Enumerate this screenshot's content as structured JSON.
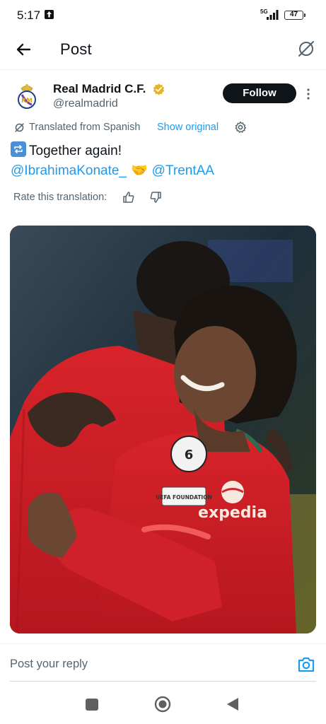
{
  "status_bar": {
    "time": "5:17",
    "network": "5G",
    "battery": "47"
  },
  "header": {
    "title": "Post"
  },
  "post": {
    "author": {
      "display_name": "Real Madrid C.F.",
      "handle": "@realmadrid"
    },
    "follow_label": "Follow",
    "translated_label": "Translated from Spanish",
    "show_original_label": "Show original",
    "text_line1": "Together again!",
    "mention1": "@IbrahimaKonate_",
    "handshake": "🤝",
    "mention2": "@TrentAA",
    "rate_label": "Rate this translation:"
  },
  "photo": {
    "jersey_sponsor": "expedia",
    "badge_text": "UEFA FOUNDATION",
    "sleeve_number": "6"
  },
  "reply": {
    "placeholder": "Post your reply"
  },
  "colors": {
    "accent": "#1d9bf0",
    "text_primary": "#0f1419",
    "text_secondary": "#536471",
    "verified_gold": "#e8b321"
  }
}
